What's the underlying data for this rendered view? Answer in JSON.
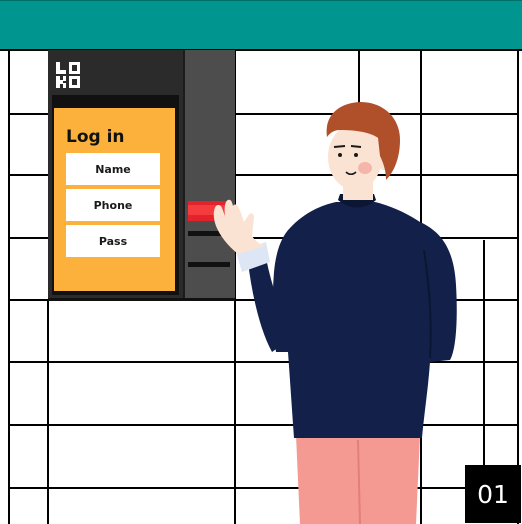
{
  "colors": {
    "header": "#00958f",
    "kiosk_body": "#2b2b2b",
    "screen": "#fbb13c",
    "side_panel": "#4d4d4d",
    "scanner_light": "#e3232b",
    "sweater": "#13214a",
    "pants": "#f59a93",
    "hair": "#b0502a",
    "skin": "#fbe3d4"
  },
  "kiosk": {
    "logo_icon": "grid-logo-icon",
    "title": "Log in",
    "fields": [
      "Name",
      "Phone",
      "Pass"
    ]
  },
  "step_badge": "01"
}
